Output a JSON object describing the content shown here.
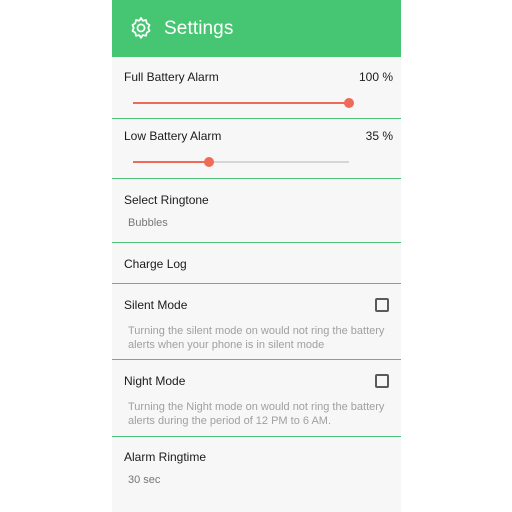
{
  "appbar": {
    "title": "Settings",
    "icon": "gear-icon",
    "color": "#46c672"
  },
  "settings": {
    "full_battery": {
      "label": "Full Battery Alarm",
      "value_text": "100 %",
      "level": 1.0
    },
    "low_battery": {
      "label": "Low Battery Alarm",
      "value_text": "35 %",
      "level": 0.35
    },
    "ringtone": {
      "label": "Select Ringtone",
      "value": "Bubbles"
    },
    "charge_log": {
      "label": "Charge Log"
    },
    "silent_mode": {
      "label": "Silent Mode",
      "checked": false,
      "description": "Turning the silent mode on would not ring the battery alerts when your phone is in silent mode"
    },
    "night_mode": {
      "label": "Night Mode",
      "checked": false,
      "description": "Turning the Night mode on would not ring the battery alerts during the period of 12 PM to 6 AM."
    },
    "alarm_ringtime": {
      "label": "Alarm Ringtime",
      "value": "30 sec"
    }
  },
  "colors": {
    "accent": "#ee6b5a",
    "divider": "#4fc27a"
  }
}
